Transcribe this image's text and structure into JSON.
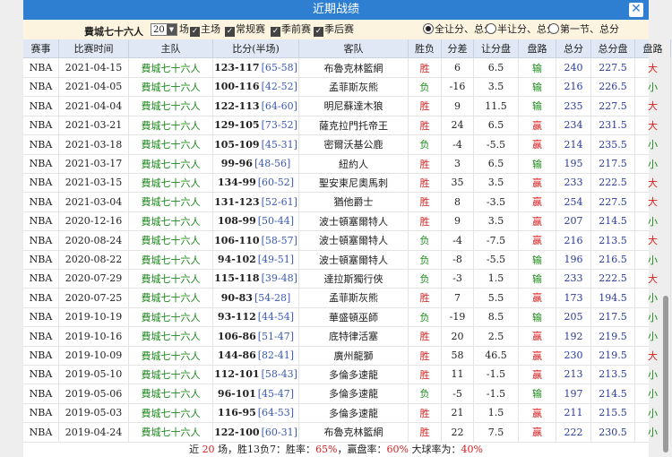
{
  "title": "近期战绩",
  "close_label": "✕",
  "filter": {
    "team": "費城七十六人",
    "count": "20",
    "count_suffix": "场",
    "checks": [
      {
        "label": "主场",
        "checked": true
      },
      {
        "label": "常规赛",
        "checked": true
      },
      {
        "label": "季前赛",
        "checked": true
      },
      {
        "label": "季后赛",
        "checked": true
      }
    ],
    "radios": [
      {
        "label": "全让分、总分",
        "checked": true
      },
      {
        "label": "半让分、总分",
        "checked": false
      },
      {
        "label": "第一节、总分",
        "checked": false
      }
    ]
  },
  "columns": [
    "赛事",
    "比赛时间",
    "主队",
    "比分(半场)",
    "客队",
    "胜负",
    "分差",
    "让分盘",
    "盘路",
    "总分",
    "总分盘",
    "盘路"
  ],
  "rows": [
    [
      "NBA",
      "2021-04-15",
      "費城七十六人",
      "123-117",
      "[65-58]",
      "布魯克林籃網",
      "胜",
      "6",
      "6.5",
      "输",
      "240",
      "227.5",
      "大"
    ],
    [
      "NBA",
      "2021-04-05",
      "費城七十六人",
      "100-116",
      "[42-52]",
      "孟菲斯灰熊",
      "负",
      "-16",
      "3.5",
      "输",
      "216",
      "226.5",
      "小"
    ],
    [
      "NBA",
      "2021-04-04",
      "費城七十六人",
      "122-113",
      "[64-60]",
      "明尼蘇達木狼",
      "胜",
      "9",
      "11.5",
      "输",
      "235",
      "227.5",
      "大"
    ],
    [
      "NBA",
      "2021-03-21",
      "費城七十六人",
      "129-105",
      "[73-52]",
      "薩克拉門托帝王",
      "胜",
      "24",
      "6.5",
      "赢",
      "234",
      "231.5",
      "大"
    ],
    [
      "NBA",
      "2021-03-18",
      "費城七十六人",
      "105-109",
      "[45-31]",
      "密爾沃基公鹿",
      "负",
      "-4",
      "-5.5",
      "赢",
      "214",
      "235.5",
      "小"
    ],
    [
      "NBA",
      "2021-03-17",
      "費城七十六人",
      "99-96",
      "[48-56]",
      "紐約人",
      "胜",
      "3",
      "6.5",
      "输",
      "195",
      "217.5",
      "小"
    ],
    [
      "NBA",
      "2021-03-15",
      "費城七十六人",
      "134-99",
      "[60-52]",
      "聖安東尼奧馬刺",
      "胜",
      "35",
      "3.5",
      "赢",
      "233",
      "222.5",
      "大"
    ],
    [
      "NBA",
      "2021-03-04",
      "費城七十六人",
      "131-123",
      "[52-61]",
      "猶他爵士",
      "胜",
      "8",
      "-3.5",
      "赢",
      "254",
      "227.5",
      "大"
    ],
    [
      "NBA",
      "2020-12-16",
      "費城七十六人",
      "108-99",
      "[50-44]",
      "波士頓塞爾特人",
      "胜",
      "9",
      "3.5",
      "赢",
      "207",
      "214.5",
      "小"
    ],
    [
      "NBA",
      "2020-08-24",
      "費城七十六人",
      "106-110",
      "[58-57]",
      "波士頓塞爾特人",
      "负",
      "-4",
      "-7.5",
      "赢",
      "216",
      "213.5",
      "大"
    ],
    [
      "NBA",
      "2020-08-22",
      "費城七十六人",
      "94-102",
      "[49-51]",
      "波士頓塞爾特人",
      "负",
      "-8",
      "-5.5",
      "输",
      "196",
      "216.5",
      "小"
    ],
    [
      "NBA",
      "2020-07-29",
      "費城七十六人",
      "115-118",
      "[39-48]",
      "達拉斯獨行俠",
      "负",
      "-3",
      "1.5",
      "输",
      "233",
      "222.5",
      "大"
    ],
    [
      "NBA",
      "2020-07-25",
      "費城七十六人",
      "90-83",
      "[54-28]",
      "孟菲斯灰熊",
      "胜",
      "7",
      "5.5",
      "赢",
      "173",
      "194.5",
      "小"
    ],
    [
      "NBA",
      "2019-10-19",
      "費城七十六人",
      "93-112",
      "[44-54]",
      "華盛頓巫師",
      "负",
      "-19",
      "8.5",
      "输",
      "205",
      "217.5",
      "小"
    ],
    [
      "NBA",
      "2019-10-16",
      "費城七十六人",
      "106-86",
      "[51-47]",
      "底特律活塞",
      "胜",
      "20",
      "2.5",
      "赢",
      "192",
      "219.5",
      "小"
    ],
    [
      "NBA",
      "2019-10-09",
      "費城七十六人",
      "144-86",
      "[82-41]",
      "廣州龍獅",
      "胜",
      "58",
      "46.5",
      "赢",
      "230",
      "219.5",
      "大"
    ],
    [
      "NBA",
      "2019-05-10",
      "費城七十六人",
      "112-101",
      "[58-43]",
      "多倫多速龍",
      "胜",
      "11",
      "-1.5",
      "赢",
      "213",
      "213.5",
      "小"
    ],
    [
      "NBA",
      "2019-05-06",
      "費城七十六人",
      "96-101",
      "[45-47]",
      "多倫多速龍",
      "负",
      "-5",
      "-1.5",
      "输",
      "197",
      "214.5",
      "小"
    ],
    [
      "NBA",
      "2019-05-03",
      "費城七十六人",
      "116-95",
      "[64-53]",
      "多倫多速龍",
      "胜",
      "21",
      "1.5",
      "赢",
      "211",
      "215.5",
      "小"
    ],
    [
      "NBA",
      "2019-04-24",
      "費城七十六人",
      "122-100",
      "[60-31]",
      "布魯克林籃網",
      "胜",
      "22",
      "7.5",
      "赢",
      "222",
      "230.5",
      "小"
    ]
  ],
  "footer": {
    "p1": "近 ",
    "n": "20",
    "p2": " 场，胜13负7：胜率：",
    "win_rate": "65%",
    "p3": "，赢盘率：",
    "cover_rate": "60%",
    "p4": " 大球率为：",
    "over_rate": "40%"
  }
}
